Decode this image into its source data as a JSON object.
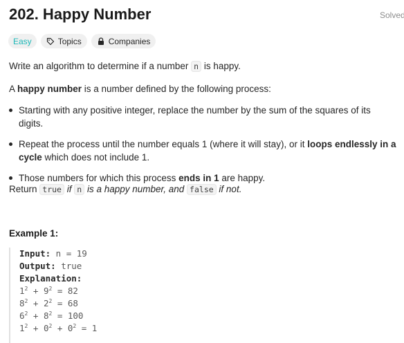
{
  "header": {
    "title": "202. Happy Number",
    "solved_label": "Solved"
  },
  "tags": {
    "difficulty": "Easy",
    "topics": "Topics",
    "companies": "Companies"
  },
  "description": {
    "p1_before": "Write an algorithm to determine if a number ",
    "p1_code": "n",
    "p1_after": " is happy.",
    "p2_before": "A ",
    "p2_bold": "happy number",
    "p2_after": " is a number defined by the following process:",
    "bullet1": "Starting with any positive integer, replace the number by the sum of the squares of its digits.",
    "bullet2_before": "Repeat the process until the number equals 1 (where it will stay), or it ",
    "bullet2_bold": "loops endlessly in a cycle",
    "bullet2_after": " which does not include 1.",
    "bullet3_before": "Those numbers for which this process ",
    "bullet3_bold": "ends in 1",
    "bullet3_after": " are happy.",
    "p3_before": "Return ",
    "p3_code1": "true",
    "p3_mid1": " if ",
    "p3_code2": "n",
    "p3_mid2": " is a happy number, and ",
    "p3_code3": "false",
    "p3_after": " if not."
  },
  "example1": {
    "title": "Example 1:",
    "input_label": "Input:",
    "input_value": " n = 19",
    "output_label": "Output:",
    "output_value": " true",
    "explanation_label": "Explanation:",
    "steps": [
      {
        "a": "1",
        "b": "9",
        "c": null,
        "result": "82"
      },
      {
        "a": "8",
        "b": "2",
        "c": null,
        "result": "68"
      },
      {
        "a": "6",
        "b": "8",
        "c": null,
        "result": "100"
      },
      {
        "a": "1",
        "b": "0",
        "c": "0",
        "result": "1"
      }
    ],
    "exponent": "2"
  }
}
